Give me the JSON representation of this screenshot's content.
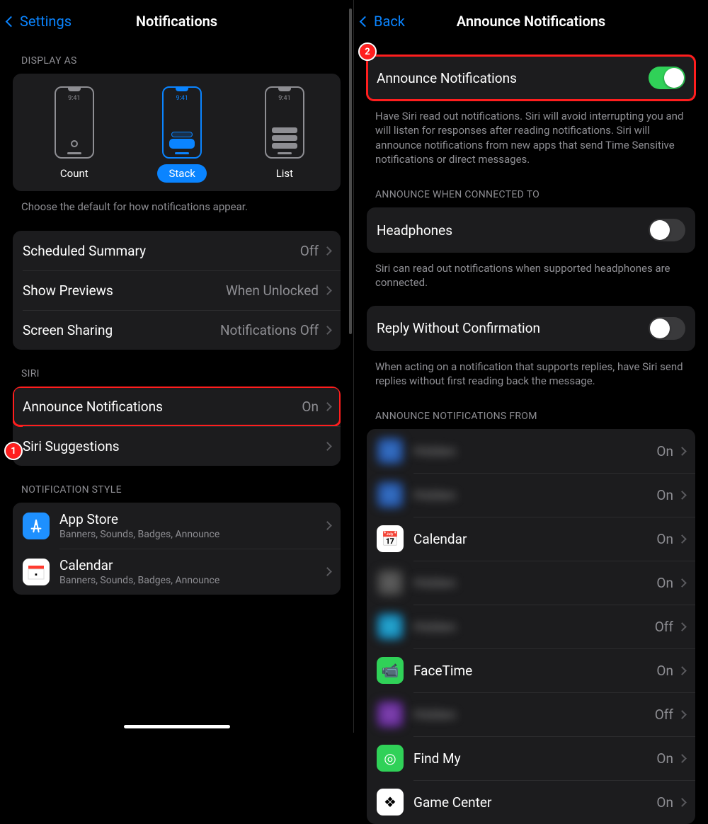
{
  "left": {
    "nav": {
      "back": "Settings",
      "title": "Notifications"
    },
    "displayAs": {
      "header": "Display As",
      "options": {
        "count": "Count",
        "stack": "Stack",
        "list": "List",
        "time": "9:41"
      },
      "footer": "Choose the default for how notifications appear."
    },
    "group1": {
      "scheduledSummary": {
        "label": "Scheduled Summary",
        "value": "Off"
      },
      "showPreviews": {
        "label": "Show Previews",
        "value": "When Unlocked"
      },
      "screenSharing": {
        "label": "Screen Sharing",
        "value": "Notifications Off"
      }
    },
    "siri": {
      "header": "Siri",
      "announce": {
        "label": "Announce Notifications",
        "value": "On"
      },
      "suggestions": {
        "label": "Siri Suggestions"
      }
    },
    "style": {
      "header": "Notification Style",
      "apps": [
        {
          "name": "App Store",
          "sub": "Banners, Sounds, Badges, Announce"
        },
        {
          "name": "Calendar",
          "sub": "Banners, Sounds, Badges, Announce"
        }
      ]
    }
  },
  "right": {
    "nav": {
      "back": "Back",
      "title": "Announce Notifications"
    },
    "main": {
      "label": "Announce Notifications",
      "desc": "Have Siri read out notifications. Siri will avoid interrupting you and will listen for responses after reading notifications. Siri will announce notifications from new apps that send Time Sensitive notifications or direct messages."
    },
    "connected": {
      "header": "Announce When Connected To",
      "headphones": {
        "label": "Headphones"
      },
      "desc": "Siri can read out notifications when supported headphones are connected."
    },
    "reply": {
      "label": "Reply Without Confirmation",
      "desc": "When acting on a notification that supports replies, have Siri send replies without first reading back the message."
    },
    "from": {
      "header": "Announce Notifications From",
      "apps": [
        {
          "name": "Hidden",
          "value": "On",
          "blur": true,
          "iconClass": "blur-icon-blue"
        },
        {
          "name": "Hidden",
          "value": "On",
          "blur": true,
          "iconClass": "blur-icon-blue"
        },
        {
          "name": "Calendar",
          "value": "On",
          "blur": false,
          "icon": "📅",
          "iconBg": "#fff"
        },
        {
          "name": "Hidden",
          "value": "On",
          "blur": true,
          "iconClass": "blur-icon-grey"
        },
        {
          "name": "Hidden",
          "value": "Off",
          "blur": true,
          "iconClass": "blur-icon-cyan"
        },
        {
          "name": "FaceTime",
          "value": "On",
          "blur": false,
          "icon": "📹",
          "iconBg": "#30d158"
        },
        {
          "name": "Hidden",
          "value": "Off",
          "blur": true,
          "iconClass": "blur-icon-purple"
        },
        {
          "name": "Find My",
          "value": "On",
          "blur": false,
          "icon": "◎",
          "iconBg": "#30d158"
        },
        {
          "name": "Game Center",
          "value": "On",
          "blur": false,
          "icon": "❖",
          "iconBg": "#fff"
        }
      ]
    }
  },
  "badges": {
    "one": "1",
    "two": "2"
  }
}
